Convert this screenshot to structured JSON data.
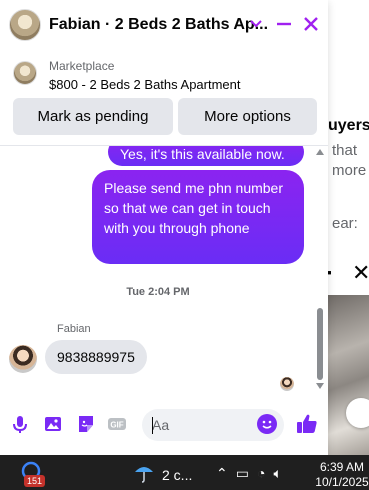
{
  "chat": {
    "title": "Fabian · 2 Beds 2 Baths Ap...",
    "listing": {
      "category": "Marketplace",
      "name": "$800 - 2 Beds 2 Baths Apartment"
    },
    "buttons": {
      "mark_pending": "Mark as pending",
      "more_options": "More options"
    },
    "messages": {
      "out_1": "Yes, it's this available now.",
      "out_2": "Please send me  phn number so that we can get in touch with you through phone",
      "time": "Tue 2:04 PM",
      "sender": "Fabian",
      "in_1": "9838889975"
    },
    "composer": {
      "placeholder": "Aa"
    }
  },
  "background_page": {
    "title": "uyers",
    "lines": [
      "that",
      "more",
      "ear:"
    ]
  },
  "taskbar": {
    "badge": "151",
    "weather": "2 c...",
    "time": "6:39 AM",
    "date": "10/1/2025"
  },
  "colors": {
    "accent": "#7a2af5",
    "gradient_top": "#8b24f0",
    "gradient_bottom": "#6a2df5",
    "taskbar": "#1f1f1f"
  },
  "icons": [
    "minimize-icon",
    "close-icon",
    "chevron-down-icon",
    "mic-icon",
    "image-icon",
    "sticker-icon",
    "gif-icon",
    "emoji-icon",
    "thumbs-up-icon",
    "weather-icon",
    "wifi-icon",
    "volume-icon"
  ]
}
